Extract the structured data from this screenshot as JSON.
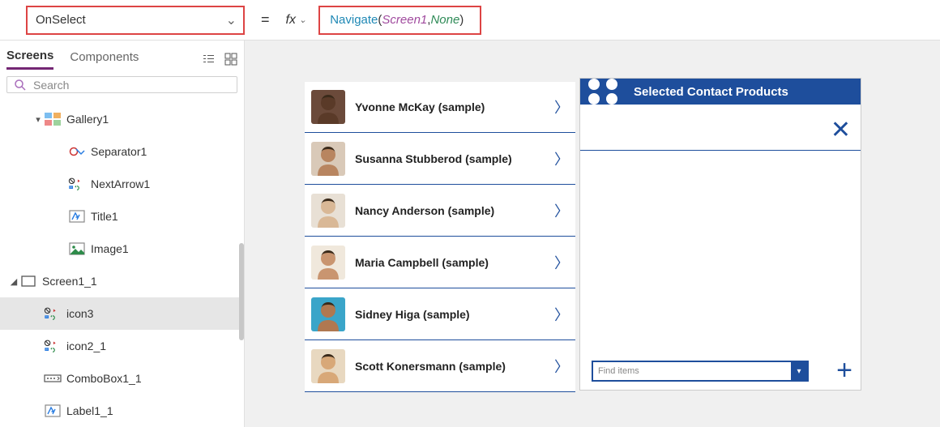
{
  "formula_bar": {
    "property": "OnSelect",
    "equals": "=",
    "fx": "fx",
    "formula": {
      "func": "Navigate",
      "lp": "( ",
      "arg1": "Screen1",
      "comma": ", ",
      "arg2": "None",
      "rp": " )"
    }
  },
  "sidebar": {
    "tabs": {
      "screens": "Screens",
      "components": "Components"
    },
    "search_placeholder": "Search",
    "tree": [
      {
        "label": "Gallery1",
        "depth": 2,
        "icon": "gallery",
        "toggle": "▾"
      },
      {
        "label": "Separator1",
        "depth": 3,
        "icon": "separator"
      },
      {
        "label": "NextArrow1",
        "depth": 3,
        "icon": "state"
      },
      {
        "label": "Title1",
        "depth": 3,
        "icon": "title"
      },
      {
        "label": "Image1",
        "depth": 3,
        "icon": "image"
      },
      {
        "label": "Screen1_1",
        "depth": 1,
        "icon": "screen",
        "toggle": "◢"
      },
      {
        "label": "icon3",
        "depth": 2,
        "icon": "state",
        "selected": true
      },
      {
        "label": "icon2_1",
        "depth": 2,
        "icon": "state"
      },
      {
        "label": "ComboBox1_1",
        "depth": 2,
        "icon": "combo"
      },
      {
        "label": "Label1_1",
        "depth": 2,
        "icon": "title"
      }
    ]
  },
  "gallery_items": [
    {
      "name": "Yvonne McKay (sample)",
      "av_bg": "#6b4a3a",
      "av_skin": "#5a3a28"
    },
    {
      "name": "Susanna Stubberod (sample)",
      "av_bg": "#d9c9b8",
      "av_skin": "#b88560"
    },
    {
      "name": "Nancy Anderson (sample)",
      "av_bg": "#e8e0d5",
      "av_skin": "#d9b896"
    },
    {
      "name": "Maria Campbell (sample)",
      "av_bg": "#f0e8dc",
      "av_skin": "#c99570"
    },
    {
      "name": "Sidney Higa (sample)",
      "av_bg": "#3aa5c9",
      "av_skin": "#b07850"
    },
    {
      "name": "Scott Konersmann (sample)",
      "av_bg": "#e8d8c0",
      "av_skin": "#d8a878"
    }
  ],
  "detail": {
    "header": "Selected Contact Products",
    "find_placeholder": "Find items"
  }
}
